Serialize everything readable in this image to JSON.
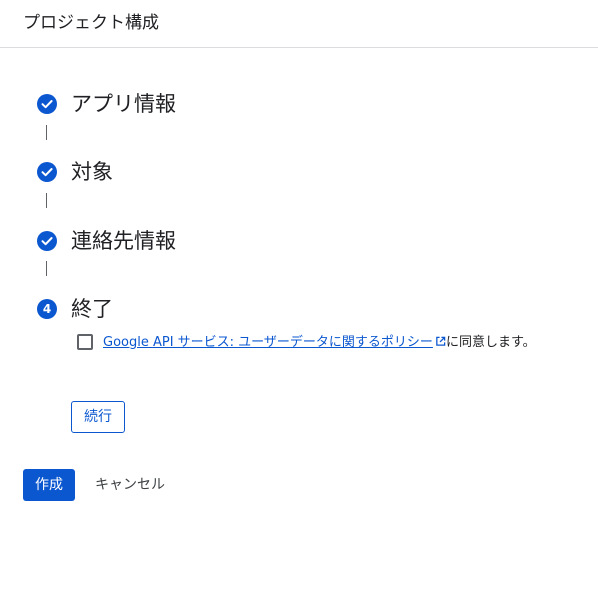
{
  "header": {
    "title": "プロジェクト構成"
  },
  "steps": [
    {
      "label": "アプリ情報",
      "status": "completed",
      "icon": "check-icon"
    },
    {
      "label": "対象",
      "status": "completed",
      "icon": "check-icon"
    },
    {
      "label": "連絡先情報",
      "status": "completed",
      "icon": "check-icon"
    },
    {
      "label": "終了",
      "status": "current",
      "number": "4"
    }
  ],
  "consent": {
    "checked": false,
    "link_text": "Google API サービス: ユーザーデータに関するポリシー",
    "link_icon": "external-link-icon",
    "suffix": "に同意します。"
  },
  "buttons": {
    "continue": "続行",
    "create": "作成",
    "cancel": "キャンセル"
  },
  "colors": {
    "accent": "#0b57d0",
    "text": "#202124",
    "divider": "#dadce0"
  }
}
